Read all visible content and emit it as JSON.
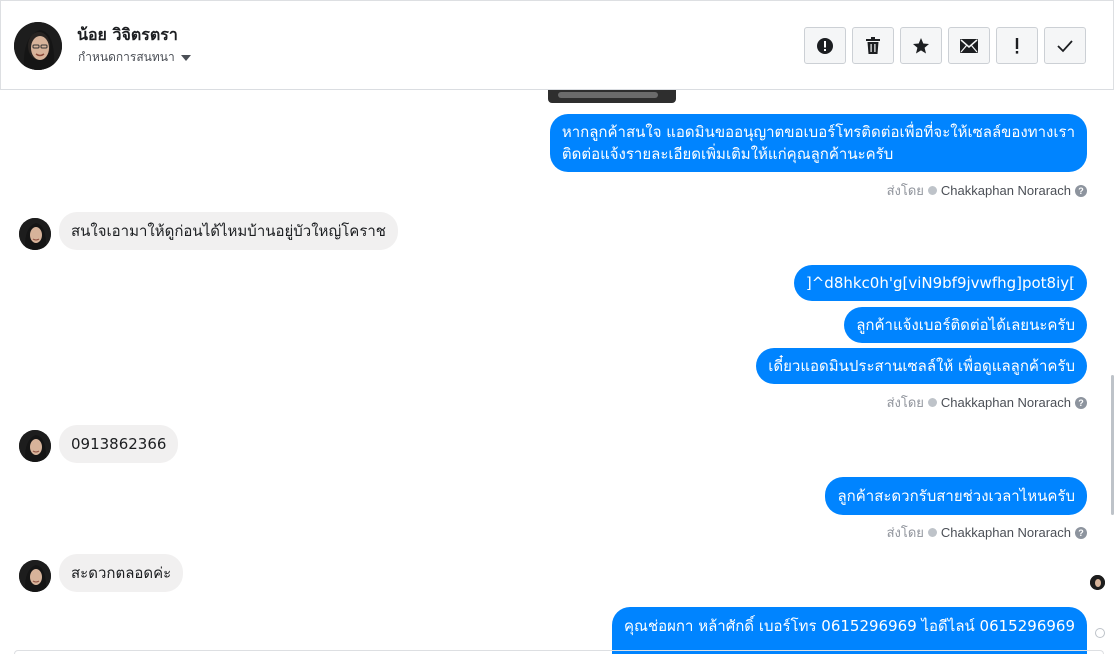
{
  "header": {
    "contact_name": "น้อย วิจิตรตรา",
    "assign_label": "กำหนดการสนทนา",
    "actions": [
      {
        "name": "report-spam",
        "icon": "alert-circle-icon"
      },
      {
        "name": "delete",
        "icon": "trash-icon"
      },
      {
        "name": "star",
        "icon": "star-icon"
      },
      {
        "name": "mark-unread",
        "icon": "envelope-icon"
      },
      {
        "name": "follow-up",
        "icon": "exclamation-icon"
      },
      {
        "name": "mark-done",
        "icon": "check-icon"
      }
    ]
  },
  "thread": {
    "messages": [
      {
        "side": "out",
        "lines": [
          "หากลูกค้าสนใจ แอดมินขออนุญาตขอเบอร์โทรติดต่อเพื่อที่จะให้เซลล์ของทางเรา",
          "ติดต่อแจ้งรายละเอียดเพิ่มเติมให้แก่คุณลูกค้านะครับ"
        ]
      },
      {
        "side": "in",
        "text": "สนใจเอามาให้ดูก่อนได้ไหมบ้านอยู่บัวใหญ่โคราช"
      },
      {
        "side": "out",
        "text": "]^d8hkc0h'g[viN9bf9jvwfhg]pot8iy["
      },
      {
        "side": "out",
        "text": "ลูกค้าแจ้งเบอร์ติดต่อได้เลยนะครับ"
      },
      {
        "side": "out",
        "text": "เดี๋ยวแอดมินประสานเซลล์ให้ เพื่อดูแลลูกค้าครับ"
      },
      {
        "side": "in",
        "text": "0913862366"
      },
      {
        "side": "out",
        "text": "ลูกค้าสะดวกรับสายช่วงเวลาไหนครับ"
      },
      {
        "side": "in",
        "text": "สะดวกตลอดค่ะ"
      },
      {
        "side": "out",
        "text": "คุณช่อผกา หล้าศักดิ์       เบอร์โทร 0615296969  ไอดีไลน์ 0615296969"
      }
    ],
    "sent_by_label": "ส่งโดย",
    "agent_name": "Chakkaphan Norarach",
    "help_glyph": "?"
  },
  "colors": {
    "outgoing_bubble": "#0084ff",
    "incoming_bubble": "#f1f0f0",
    "meta_text": "#90949c"
  }
}
